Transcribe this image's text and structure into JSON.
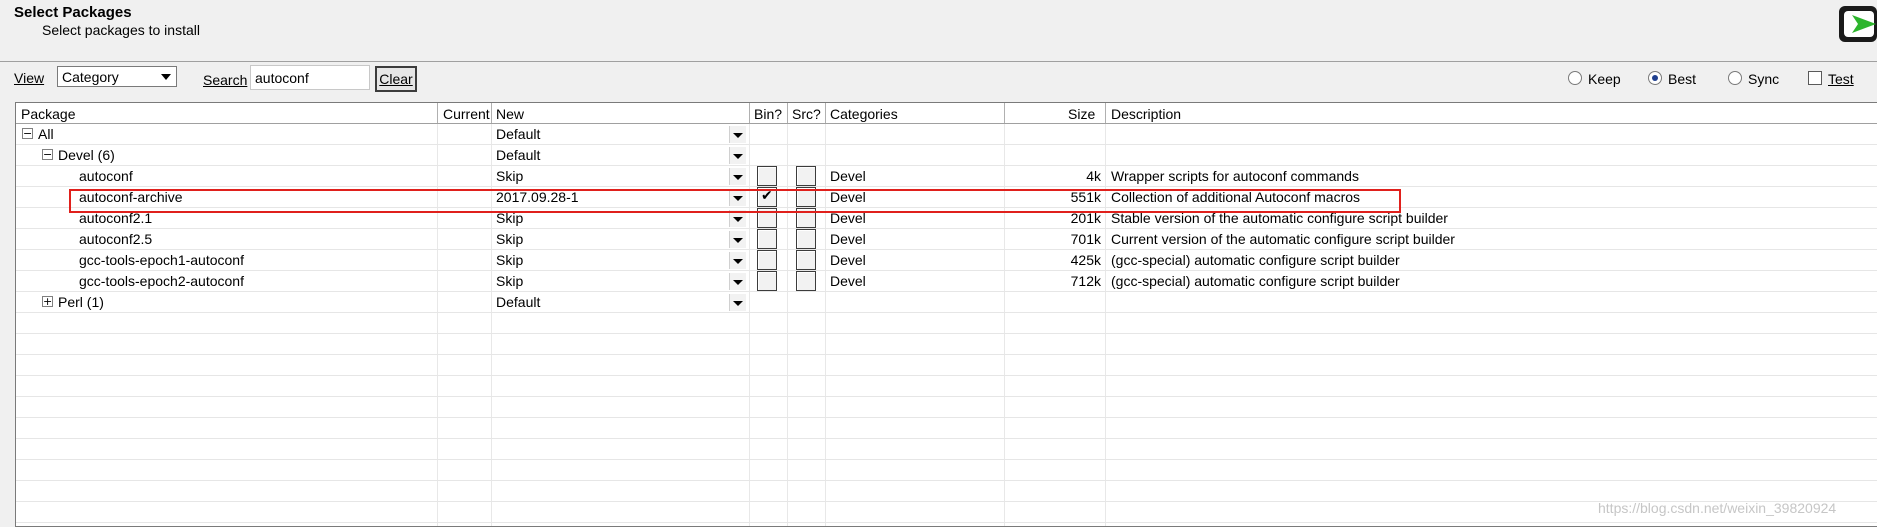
{
  "header": {
    "title": "Select Packages",
    "subtitle": "Select packages to install"
  },
  "toolbar": {
    "view_label": "View",
    "view_value": "Category",
    "search_label": "Search",
    "search_value": "autoconf",
    "clear_label": "Clear",
    "radios": [
      {
        "label": "Keep",
        "checked": false
      },
      {
        "label": "Best",
        "checked": true
      },
      {
        "label": "Sync",
        "checked": false
      }
    ],
    "test_label": "Test",
    "test_checked": false
  },
  "columns": {
    "package": "Package",
    "current": "Current",
    "new": "New",
    "bin": "Bin?",
    "src": "Src?",
    "categories": "Categories",
    "size": "Size",
    "description": "Description"
  },
  "rows": [
    {
      "type": "group",
      "expander": "−",
      "label": "All",
      "new": "Default"
    },
    {
      "type": "group",
      "expander": "−",
      "label": "Devel (6)",
      "new": "Default"
    },
    {
      "type": "package",
      "name": "autoconf",
      "current": "",
      "new": "Skip",
      "bin": false,
      "src": false,
      "category": "Devel",
      "size": "4k",
      "description": "Wrapper scripts for autoconf commands"
    },
    {
      "type": "package",
      "name": "autoconf-archive",
      "current": "",
      "new": "2017.09.28-1",
      "bin": true,
      "src": false,
      "category": "Devel",
      "size": "551k",
      "description": "Collection of additional Autoconf macros"
    },
    {
      "type": "package",
      "name": "autoconf2.1",
      "current": "",
      "new": "Skip",
      "bin": false,
      "src": false,
      "category": "Devel",
      "size": "201k",
      "description": "Stable version of the automatic configure script builder"
    },
    {
      "type": "package",
      "name": "autoconf2.5",
      "current": "",
      "new": "Skip",
      "bin": false,
      "src": false,
      "category": "Devel",
      "size": "701k",
      "description": "Current version of the automatic configure script builder"
    },
    {
      "type": "package",
      "name": "gcc-tools-epoch1-autoconf",
      "current": "",
      "new": "Skip",
      "bin": false,
      "src": false,
      "category": "Devel",
      "size": "425k",
      "description": "(gcc-special) automatic configure script builder"
    },
    {
      "type": "package",
      "name": "gcc-tools-epoch2-autoconf",
      "current": "",
      "new": "Skip",
      "bin": false,
      "src": false,
      "category": "Devel",
      "size": "712k",
      "description": "(gcc-special) automatic configure script builder"
    },
    {
      "type": "group",
      "expander": "+",
      "label": "Perl (1)",
      "new": "Default"
    }
  ],
  "watermark": "https://blog.csdn.net/weixin_39820924",
  "colors": {
    "highlight": "#e0201c",
    "logo_green": "#2db52d"
  }
}
